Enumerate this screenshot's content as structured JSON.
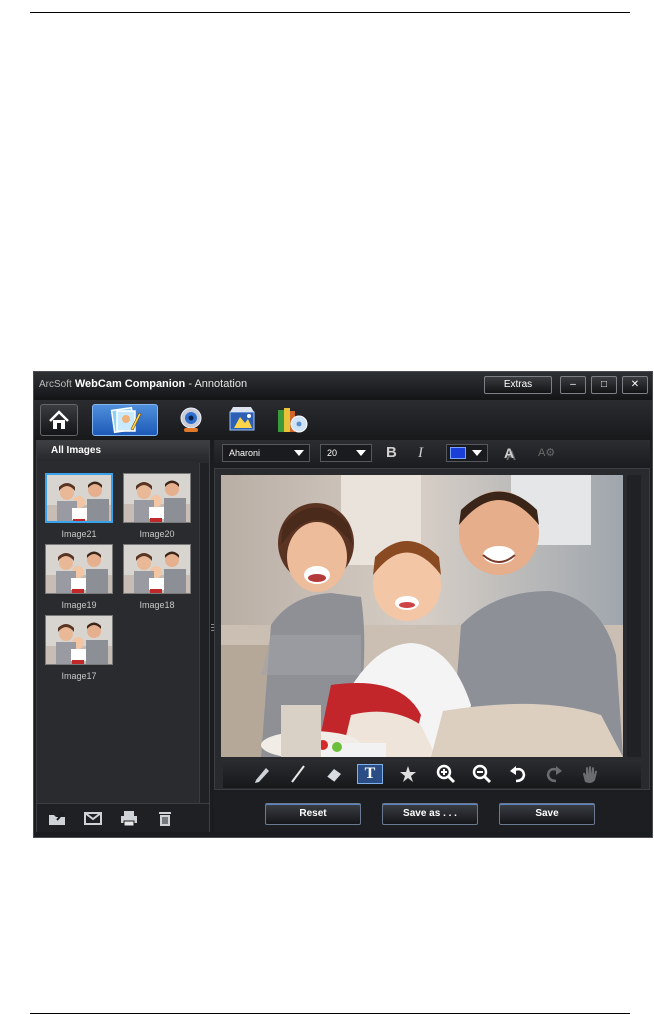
{
  "window": {
    "title_brand": "ArcSoft",
    "title_app": "WebCam Companion",
    "title_suffix": " - Annotation",
    "extras_label": "Extras",
    "close_glyph": "✕",
    "min_glyph": "–",
    "max_glyph": "□"
  },
  "nav": {
    "items": [
      {
        "name": "home",
        "icon": "home-icon"
      },
      {
        "name": "annotate",
        "icon": "photo-annotate-icon",
        "active": true
      },
      {
        "name": "webcam",
        "icon": "webcam-icon"
      },
      {
        "name": "video",
        "icon": "video-edit-icon"
      },
      {
        "name": "disc",
        "icon": "disc-burn-icon"
      }
    ]
  },
  "left_panel": {
    "header": "All Images",
    "thumbnails": [
      {
        "label": "Image21",
        "selected": true
      },
      {
        "label": "Image20"
      },
      {
        "label": "Image19"
      },
      {
        "label": "Image18"
      },
      {
        "label": "Image17"
      }
    ],
    "tools": [
      "export-icon",
      "email-icon",
      "print-icon",
      "trash-icon"
    ]
  },
  "text_toolbar": {
    "font": "Aharoni",
    "size": "20",
    "bold_glyph": "B",
    "italic_glyph": "I",
    "text_color": "#1a3ed8",
    "effect_glyph": "A",
    "effect2_glyph": "A⚙"
  },
  "draw_tools": [
    {
      "name": "pencil-tool",
      "icon": "pencil-icon"
    },
    {
      "name": "line-tool",
      "icon": "line-icon"
    },
    {
      "name": "eraser-tool",
      "icon": "eraser-icon"
    },
    {
      "name": "text-tool",
      "icon": "text-icon",
      "active": true,
      "glyph": "T"
    },
    {
      "name": "stamp-tool",
      "icon": "stamp-icon"
    },
    {
      "name": "zoom-in-tool",
      "icon": "zoom-in-icon"
    },
    {
      "name": "zoom-out-tool",
      "icon": "zoom-out-icon"
    },
    {
      "name": "undo-tool",
      "icon": "undo-icon"
    },
    {
      "name": "redo-tool",
      "icon": "redo-icon",
      "disabled": true
    },
    {
      "name": "pan-tool",
      "icon": "hand-icon",
      "disabled": true
    }
  ],
  "actions": {
    "reset": "Reset",
    "save_as": "Save as . . .",
    "save": "Save"
  }
}
